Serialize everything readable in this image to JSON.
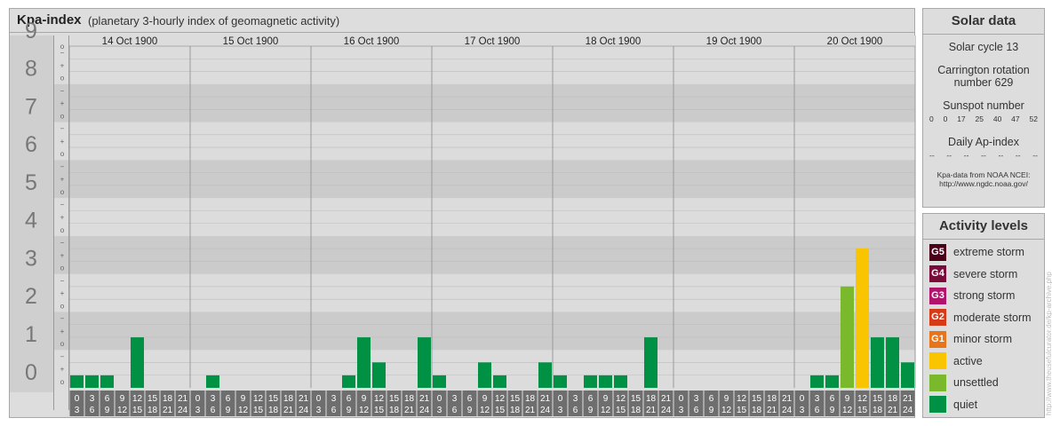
{
  "chart_data": {
    "type": "bar",
    "title": "Kpa-index",
    "subtitle": "(planetary 3-hourly index of geomagnetic activity)",
    "ylim": [
      0,
      9
    ],
    "y_major_labels": [
      "0",
      "1",
      "2",
      "3",
      "4",
      "5",
      "6",
      "7",
      "8",
      "9"
    ],
    "y_minor_labels": [
      "+",
      "−",
      "o"
    ],
    "days": [
      {
        "date": "14 Oct 1900",
        "values": [
          0.33,
          0.33,
          0.33,
          0,
          1.33,
          0,
          0,
          0
        ]
      },
      {
        "date": "15 Oct 1900",
        "values": [
          0,
          0.33,
          0,
          0,
          0,
          0,
          0,
          0
        ]
      },
      {
        "date": "16 Oct 1900",
        "values": [
          0,
          0,
          0.33,
          1.33,
          0.67,
          0,
          0,
          1.33
        ]
      },
      {
        "date": "17 Oct 1900",
        "values": [
          0.33,
          0,
          0,
          0.67,
          0.33,
          0,
          0,
          0.67
        ]
      },
      {
        "date": "18 Oct 1900",
        "values": [
          0.33,
          0,
          0.33,
          0.33,
          0.33,
          0,
          1.33,
          0
        ]
      },
      {
        "date": "19 Oct 1900",
        "values": [
          0,
          0,
          0,
          0,
          0,
          0,
          0,
          0
        ]
      },
      {
        "date": "20 Oct 1900",
        "values": [
          0,
          0.33,
          0.33,
          2.67,
          3.67,
          1.33,
          1.33,
          0.67
        ]
      }
    ],
    "interval_start": [
      "0",
      "3",
      "6",
      "9",
      "12",
      "15",
      "18",
      "21"
    ],
    "interval_end": [
      "3",
      "6",
      "9",
      "12",
      "15",
      "18",
      "21",
      "24"
    ],
    "colors": {
      "quiet": "#009144",
      "unsettled": "#7ab82c",
      "active": "#f8c500"
    }
  },
  "solar_data": {
    "title": "Solar data",
    "solar_cycle": "Solar cycle 13",
    "carrington_line1": "Carrington rotation",
    "carrington_line2": "number 629",
    "sunspot_title": "Sunspot number",
    "sunspot_values": [
      "0",
      "0",
      "17",
      "25",
      "40",
      "47",
      "52"
    ],
    "ap_title": "Daily Ap-index",
    "ap_values": [
      "--",
      "--",
      "--",
      "--",
      "--",
      "--",
      "--"
    ],
    "source_line1": "Kpa-data from NOAA NCEI:",
    "source_line2": "http://www.ngdc.noaa.gov/"
  },
  "activity_levels": {
    "title": "Activity levels",
    "items": [
      {
        "badge": "G5",
        "label": "extreme storm",
        "color": "#4a0019"
      },
      {
        "badge": "G4",
        "label": "severe storm",
        "color": "#7a0b3a"
      },
      {
        "badge": "G3",
        "label": "strong storm",
        "color": "#b0136b"
      },
      {
        "badge": "G2",
        "label": "moderate storm",
        "color": "#d63b18"
      },
      {
        "badge": "G1",
        "label": "minor storm",
        "color": "#e8751a"
      },
      {
        "badge": "",
        "label": "active",
        "color": "#f8c500"
      },
      {
        "badge": "",
        "label": "unsettled",
        "color": "#7ab82c"
      },
      {
        "badge": "",
        "label": "quiet",
        "color": "#009144"
      }
    ]
  },
  "watermark": "http://www.theusefulcurator.de/kp-archive.php"
}
